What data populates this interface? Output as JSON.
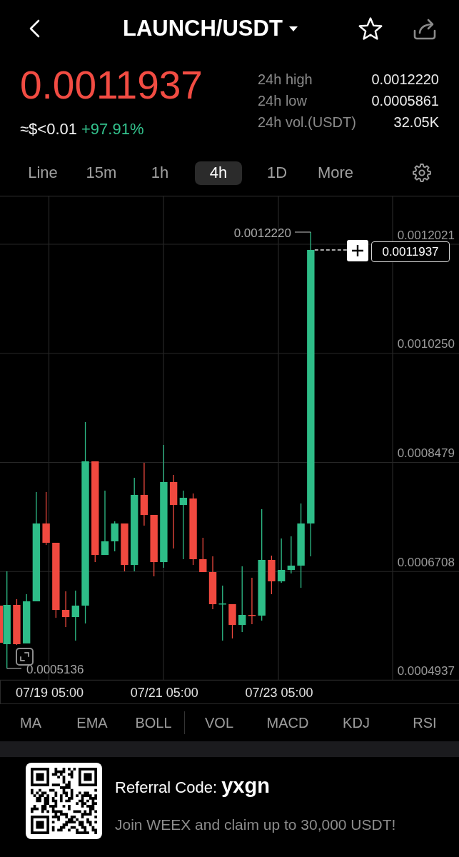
{
  "header": {
    "title": "LAUNCH/USDT"
  },
  "ticker": {
    "price": "0.0011937",
    "usd_value": "≈$<0.01",
    "change": "+97.91%"
  },
  "stats": [
    {
      "label": "24h high",
      "value": "0.0012220"
    },
    {
      "label": "24h low",
      "value": "0.0005861"
    },
    {
      "label": "24h vol.(USDT)",
      "value": "32.05K"
    }
  ],
  "intervals": [
    {
      "label": "Line",
      "selected": false
    },
    {
      "label": "15m",
      "selected": false
    },
    {
      "label": "1h",
      "selected": false
    },
    {
      "label": "4h",
      "selected": true
    },
    {
      "label": "1D",
      "selected": false
    },
    {
      "label": "More",
      "selected": false
    }
  ],
  "chart": {
    "price_axis": [
      "0.0012021",
      "0.0010250",
      "0.0008479",
      "0.0006708",
      "0.0004937"
    ],
    "high_marker": "0.0012220",
    "low_marker": "0.0005136",
    "last_price": "0.0011937",
    "time_axis": [
      "07/19 05:00",
      "07/21 05:00",
      "07/23 05:00"
    ]
  },
  "indicators": {
    "main": [
      "MA",
      "EMA",
      "BOLL"
    ],
    "sub": [
      "VOL",
      "MACD",
      "KDJ",
      "RSI"
    ]
  },
  "referral": {
    "text": "Referral Code: **yxgn**",
    "message": "Join WEEX and claim up to 30,000 USDT!"
  }
}
